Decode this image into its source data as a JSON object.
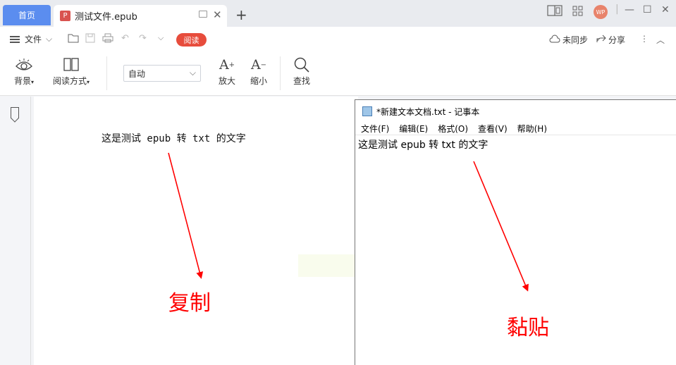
{
  "tabs": {
    "home_label": "首页",
    "doc_label": "测试文件.epub",
    "doc_icon": "P"
  },
  "window": {
    "avatar_text": "WP"
  },
  "toolbar": {
    "file_menu": "文件",
    "read_mode": "阅读",
    "unsynced": "未同步",
    "share": "分享",
    "background": "背景",
    "reading_mode": "阅读方式",
    "zoom_select": "自动",
    "zoom_in": "放大",
    "zoom_out": "缩小",
    "find": "查找"
  },
  "document": {
    "text": "这是测试 epub 转 txt 的文字",
    "annotation_copy": "复制"
  },
  "notepad": {
    "title": "*新建文本文档.txt - 记事本",
    "menu": [
      "文件(F)",
      "编辑(E)",
      "格式(O)",
      "查看(V)",
      "帮助(H)"
    ],
    "content": "这是测试 epub 转 txt 的文字",
    "annotation_paste": "黏贴"
  },
  "colors": {
    "accent_blue": "#5b8def",
    "read_pill": "#e74c3c",
    "annotation_red": "#ff0000"
  }
}
